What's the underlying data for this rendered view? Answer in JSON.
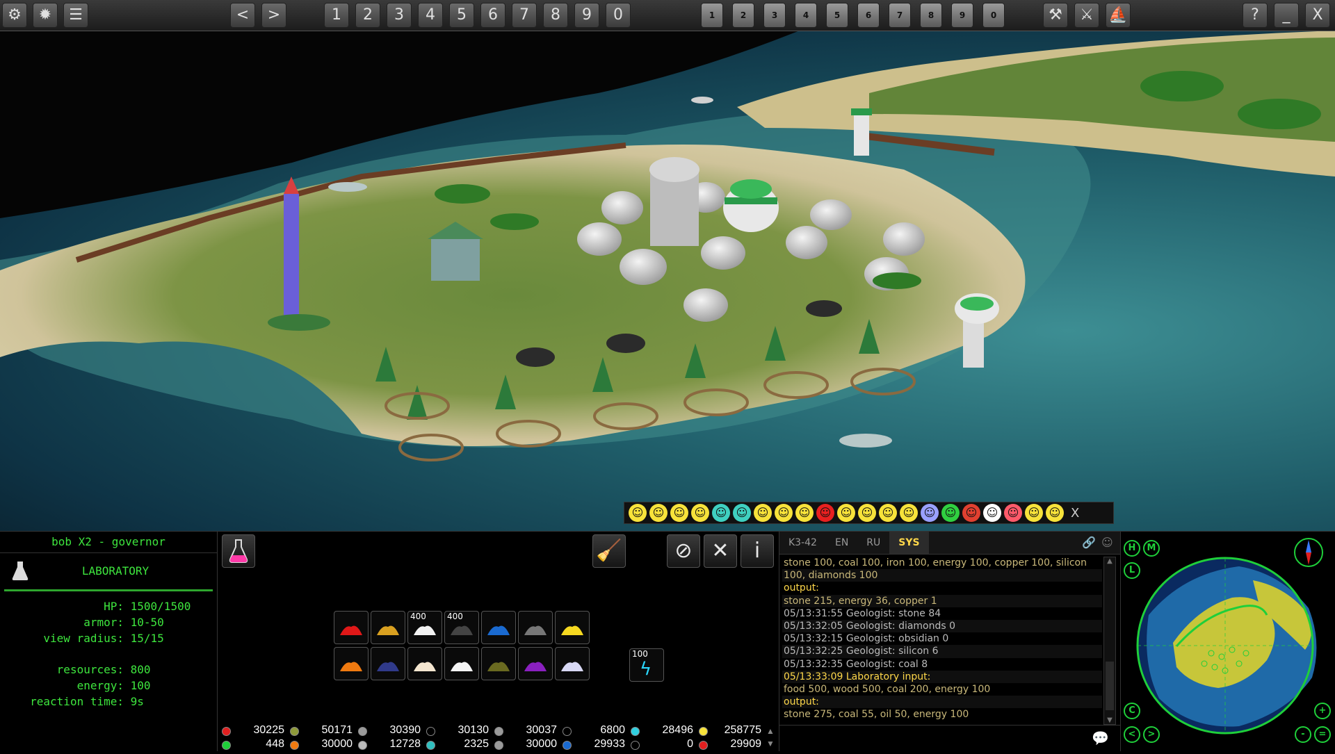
{
  "toolbar": {
    "left_icons": [
      "gear-icon",
      "sparkle-icon",
      "list-icon"
    ],
    "nav": {
      "back": "<",
      "forward": ">"
    },
    "camera_slots": [
      "1",
      "2",
      "3",
      "4",
      "5",
      "6",
      "7",
      "8",
      "9",
      "0"
    ],
    "group_slots": [
      "1",
      "2",
      "3",
      "4",
      "5",
      "6",
      "7",
      "8",
      "9",
      "0"
    ],
    "mode_icons": [
      "hammer-icon",
      "swords-icon",
      "ship-icon"
    ],
    "window": {
      "help": "?",
      "minimize": "_",
      "close": "X"
    }
  },
  "emotes": {
    "colors": [
      "#f7e23a",
      "#f7e23a",
      "#f7e23a",
      "#f7e23a",
      "#3fd0c0",
      "#3fd0c0",
      "#f7e23a",
      "#f7e23a",
      "#f7e23a",
      "#e82020",
      "#f7e23a",
      "#f7e23a",
      "#f7e23a",
      "#f7e23a",
      "#9aa0ff",
      "#30d040",
      "#e04030",
      "#ffffff",
      "#ff5a6a",
      "#f7e23a",
      "#f7e23a"
    ],
    "close": "X"
  },
  "unit_info": {
    "player": "bob X2 - governor",
    "building": "LABORATORY",
    "stats": [
      {
        "label": "HP:",
        "value": "1500/1500"
      },
      {
        "label": "armor:",
        "value": "10-50"
      },
      {
        "label": "view radius:",
        "value": "15/15"
      }
    ],
    "stats2": [
      {
        "label": "resources:",
        "value": "800"
      },
      {
        "label": "energy:",
        "value": "100"
      },
      {
        "label": "reaction time:",
        "value": "9s"
      }
    ]
  },
  "production": {
    "row1": [
      {
        "color": "#e01818",
        "count": ""
      },
      {
        "color": "#d9a020",
        "count": ""
      },
      {
        "color": "#f2f2f2",
        "count": "400"
      },
      {
        "color": "#444444",
        "count": "400"
      },
      {
        "color": "#1a6ad0",
        "count": ""
      },
      {
        "color": "#777777",
        "count": ""
      },
      {
        "color": "#f5d820",
        "count": ""
      }
    ],
    "row2": [
      {
        "color": "#f07a10",
        "count": ""
      },
      {
        "color": "#303a8a",
        "count": ""
      },
      {
        "color": "#f4e6d0",
        "count": ""
      },
      {
        "color": "#f4f4f4",
        "count": ""
      },
      {
        "color": "#6a6a20",
        "count": ""
      },
      {
        "color": "#8a20c0",
        "count": ""
      },
      {
        "color": "#d8d8f4",
        "count": ""
      }
    ],
    "energy_count": "100"
  },
  "resources": [
    {
      "color": "#e02020",
      "value": "30225",
      "value2": "448",
      "color2": "#1fcf3a"
    },
    {
      "color": "#8f9a3a",
      "value": "50171",
      "value2": "30000",
      "color2": "#f07a10"
    },
    {
      "color": "#9a9a9a",
      "value": "30390",
      "value2": "12728",
      "color2": "#bbbbbb"
    },
    {
      "color": "#000000",
      "value": "30130",
      "value2": "2325",
      "color2": "#30c0c0"
    },
    {
      "color": "#9a9a9a",
      "value": "30037",
      "value2": "30000",
      "color2": "#9a9a9a"
    },
    {
      "color": "#000000",
      "value": "6800",
      "value2": "29933",
      "color2": "#1a6ad0"
    },
    {
      "color": "#30d0e0",
      "value": "28496",
      "value2": "0",
      "color2": "#000000"
    },
    {
      "color": "#f7e23a",
      "value": "258775",
      "value2": "29909",
      "color2": "#e02020"
    }
  ],
  "chat": {
    "tabs": [
      "K3-42",
      "EN",
      "RU",
      "SYS"
    ],
    "active_tab": "SYS",
    "lines": [
      {
        "text": "stone 100, coal 100, iron 100, energy 100, copper 100, silicon",
        "color": "#c9b87a"
      },
      {
        "text": "100, diamonds 100",
        "color": "#c9b87a"
      },
      {
        "text": "output:",
        "color": "#ffd84a"
      },
      {
        "text": "stone 215, energy 36, copper 1",
        "color": "#c9b87a"
      },
      {
        "text": "05/13:31:55 Geologist: stone 84",
        "color": "#bbbbbb"
      },
      {
        "text": "05/13:32:05 Geologist: diamonds 0",
        "color": "#bbbbbb"
      },
      {
        "text": "05/13:32:15 Geologist: obsidian 0",
        "color": "#bbbbbb"
      },
      {
        "text": "05/13:32:25 Geologist: silicon 6",
        "color": "#bbbbbb"
      },
      {
        "text": "05/13:32:35 Geologist: coal 8",
        "color": "#bbbbbb"
      },
      {
        "text": "05/13:33:09 Laboratory input:",
        "color": "#ffd84a"
      },
      {
        "text": "food 500, wood 500, coal 200, energy 100",
        "color": "#c9b87a"
      },
      {
        "text": "output:",
        "color": "#ffd84a"
      },
      {
        "text": "stone 275, coal 55, oil 50, energy 100",
        "color": "#c9b87a"
      }
    ]
  },
  "minimap": {
    "buttons_left": [
      "H",
      "M",
      "L"
    ],
    "buttons_bottom_left": [
      "C",
      "<",
      ">"
    ],
    "buttons_right": [
      "+",
      "-",
      "="
    ]
  }
}
